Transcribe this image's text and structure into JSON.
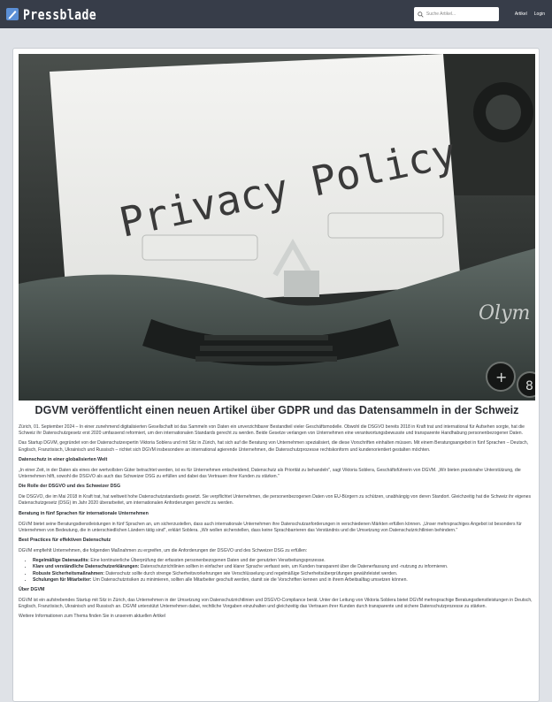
{
  "navbar": {
    "brand": "Pressblade",
    "search_placeholder": "Suche Artikel...",
    "links": [
      "Artikel",
      "Login"
    ]
  },
  "hero": {
    "paper_text": "Privacy Policy",
    "brand_plate": "Olym",
    "keys": [
      "+",
      "8"
    ],
    "icon": "typewriter-photo"
  },
  "article": {
    "title": "DGVM veröffentlicht einen neuen Artikel über GDPR und das Datensammeln in der Schweiz",
    "intro": "Zürich, 01. September 2024 – In einer zunehmend digitalisierten Gesellschaft ist das Sammeln von Daten ein unverzichtbarer Bestandteil vieler Geschäftsmodelle. Obwohl die DSGVO bereits 2018 in Kraft trat und international für Aufsehen sorgte, hat die Schweiz ihr Datenschutzgesetz erst 2020 umfassend reformiert, um den internationalen Standards gerecht zu werden. Beide Gesetze verlangen von Unternehmen eine verantwortungsbewusste und transparente Handhabung personenbezogener Daten.",
    "intro2": "Das Startup DGVM, gegründet von der Datenschutzexpertin Viktoria Soblera und mit Sitz in Zürich, hat sich auf die Beratung von Unternehmen spezialisiert, die diese Vorschriften einhalten müssen. Mit einem Beratungsangebot in fünf Sprachen – Deutsch, Englisch, Französisch, Ukrainisch und Russisch – richtet sich DGVM insbesondere an international agierende Unternehmen, die Datenschutzprozesse rechtskonform und kundenorientiert gestalten möchten.",
    "h1": "Datenschutz in einer globalisierten Welt",
    "p1": "„In einer Zeit, in der Daten als eines der wertvollsten Güter betrachtet werden, ist es für Unternehmen entscheidend, Datenschutz als Priorität zu behandeln\", sagt Viktoria Soblera, Geschäftsführerin von DGVM. „Wir bieten praxisnahe Unterstützung, die Unternehmen hilft, sowohl die DSGVO als auch das Schweizer DSG zu erfüllen und dabei das Vertrauen ihrer Kunden zu stärken.\"",
    "h2": "Die Rolle der DSGVO und des Schweizer DSG",
    "p2": "Die DSGVO, die im Mai 2018 in Kraft trat, hat weltweit hohe Datenschutzstandards gesetzt. Sie verpflichtet Unternehmen, die personenbezogenen Daten von EU-Bürgern zu schützen, unabhängig von deren Standort. Gleichzeitig hat die Schweiz ihr eigenes Datenschutzgesetz (DSG) im Jahr 2020 überarbeitet, um internationalen Anforderungen gerecht zu werden.",
    "h3": "Beratung in fünf Sprachen für internationale Unternehmen",
    "p3": "DGVM bietet seine Beratungsdienstleistungen in fünf Sprachen an, um sicherzustellen, dass auch internationale Unternehmen ihre Datenschutzanforderungen in verschiedenen Märkten erfüllen können. „Unser mehrsprachiges Angebot ist besonders für Unternehmen von Bedeutung, die in unterschiedlichen Ländern tätig sind\", erklärt Soblera. „Wir wollen sicherstellen, dass keine Sprachbarrieren das Verständnis und die Umsetzung von Datenschutzrichtlinien behindern.\"",
    "h4": "Best Practices für effektiven Datenschutz",
    "p4": "DGVM empfiehlt Unternehmen, die folgenden Maßnahmen zu ergreifen, um die Anforderungen der DSGVO und des Schweizer DSG zu erfüllen:",
    "bullets": [
      {
        "bold": "Regelmäßige Datenaudits:",
        "text": " Eine kontinuierliche Überprüfung der erfassten personenbezogenen Daten und der genutzten Verarbeitungsprozesse."
      },
      {
        "bold": "Klare und verständliche Datenschutzerklärungen:",
        "text": " Datenschutzrichtlinien sollten in einfacher und klarer Sprache verfasst sein, um Kunden transparent über die Datenerfassung und -nutzung zu informieren."
      },
      {
        "bold": "Robuste Sicherheitsmaßnahmen:",
        "text": " Datenschutz sollte durch strenge Sicherheitsvorkehrungen wie Verschlüsselung und regelmäßige Sicherheitsüberprüfungen gewährleistet werden."
      },
      {
        "bold": "Schulungen für Mitarbeiter:",
        "text": " Um Datenschutzrisiken zu minimieren, sollten alle Mitarbeiter geschult werden, damit sie die Vorschriften kennen und in ihrem Arbeitsalltag umsetzen können."
      }
    ],
    "h5": "Über DGVM",
    "p5": "DGVM ist ein aufstrebendes Startup mit Sitz in Zürich, das Unternehmen in der Umsetzung von Datenschutzrichtlinien und DSGVO-Compliance berät. Unter der Leitung von Viktoria Soblera bietet DGVM mehrsprachige Beratungsdienstleistungen in Deutsch, Englisch, Französisch, Ukrainisch und Russisch an. DGVM unterstützt Unternehmen dabei, rechtliche Vorgaben einzuhalten und gleichzeitig das Vertrauen ihrer Kunden durch transparente und sichere Datenschutzprozesse zu stärken.",
    "p6": "Weitere Informationen zum Thema finden Sie in unserem aktuellen Artikel"
  }
}
